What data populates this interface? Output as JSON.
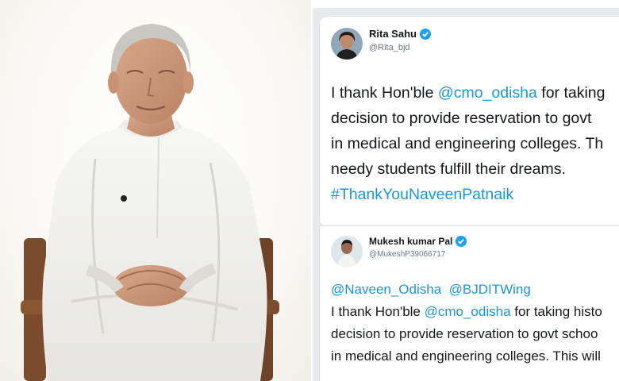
{
  "photo": {
    "subject": "portrait-photo"
  },
  "tweets": [
    {
      "name": "Rita Sahu",
      "handle": "@Rita_bjd",
      "line1_prefix": "I thank Hon'ble ",
      "line1_mention": "@cmo_odisha",
      "line1_suffix": " for taking",
      "line2": "decision to provide reservation to govt",
      "line3": "in medical and engineering colleges. Th",
      "line4": "needy students fulfill their dreams.",
      "hashtag": "#ThankYouNaveenPatnaik"
    },
    {
      "name": "Mukesh kumar Pal",
      "handle": "@MukeshP39066717",
      "mention_a": "@Naveen_Odisha",
      "mention_b": "@BJDITWing",
      "line1_prefix": "I thank Hon'ble ",
      "line1_mention": "@cmo_odisha",
      "line1_suffix": " for taking histo",
      "line2": "decision to provide reservation to govt schoo",
      "line3": "in medical and engineering colleges. This will"
    }
  ],
  "colors": {
    "link": "#1b95e0",
    "verified": "#1da1f2",
    "text": "#14171a",
    "muted": "#657786"
  }
}
